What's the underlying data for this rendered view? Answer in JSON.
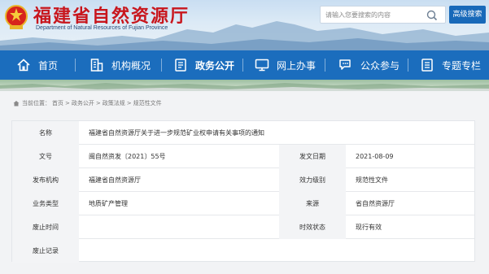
{
  "header": {
    "title": "福建省自然资源厅",
    "subtitle": "Department of Natural Resources of Fujian Province",
    "search_placeholder": "请输入您要搜索的内容",
    "advanced_search_label": "高级搜索"
  },
  "nav": {
    "items": [
      {
        "label": "首页",
        "icon": "home-icon"
      },
      {
        "label": "机构概况",
        "icon": "building-icon"
      },
      {
        "label": "政务公开",
        "icon": "document-icon",
        "active": true
      },
      {
        "label": "网上办事",
        "icon": "monitor-icon"
      },
      {
        "label": "公众参与",
        "icon": "chat-icon"
      },
      {
        "label": "专题专栏",
        "icon": "list-icon"
      }
    ]
  },
  "breadcrumb": {
    "items": [
      "当前位置：",
      "首页",
      ">",
      "政务公开",
      ">",
      "政策法规",
      ">",
      "规范性文件"
    ]
  },
  "info": {
    "rows": [
      {
        "label": "名称",
        "value": "福建省自然资源厅关于进一步规范矿业权申请有关事项的通知"
      },
      {
        "label": "文号",
        "value": "闽自然资发〔2021〕55号",
        "label2": "发文日期",
        "value2": "2021-08-09"
      },
      {
        "label": "发布机构",
        "value": "福建省自然资源厅",
        "label2": "效力级别",
        "value2": "规范性文件"
      },
      {
        "label": "业务类型",
        "value": "地质矿产管理",
        "label2": "来源",
        "value2": "省自然资源厅"
      },
      {
        "label": "废止时间",
        "value": "",
        "label2": "时效状态",
        "value2": "现行有效"
      },
      {
        "label": "废止记录",
        "value": ""
      }
    ]
  },
  "colors": {
    "brand_red": "#c8161d",
    "nav_blue": "#1b6dbd",
    "button_blue": "#1869b9"
  }
}
